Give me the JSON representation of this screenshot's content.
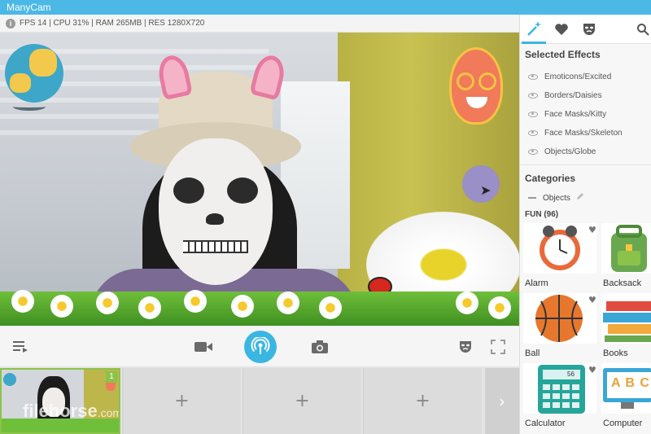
{
  "app": {
    "title": "ManyCam"
  },
  "stats": {
    "text": "FPS 14 | CPU 31% | RAM 265MB | RES 1280X720",
    "info_icon": "info-icon"
  },
  "colors": {
    "accent": "#3ab6e3",
    "title_bar": "#4cb8e6",
    "active_source": "#8bc34a"
  },
  "controls": {
    "playlist_icon": "playlist-icon",
    "video_icon": "video-camera-icon",
    "broadcast_icon": "broadcast-icon",
    "snapshot_icon": "camera-icon",
    "mask_icon": "mask-icon",
    "fullscreen_icon": "fullscreen-icon"
  },
  "sources": {
    "active_badge": "1",
    "add_label": "+",
    "next_label": "›",
    "watermark": "filehorse",
    "watermark_suffix": ".com"
  },
  "panel": {
    "tabs": [
      {
        "icon": "magic-wand-icon",
        "active": true
      },
      {
        "icon": "heart-icon",
        "active": false
      },
      {
        "icon": "mask-icon",
        "active": false
      }
    ],
    "search_icon": "search-icon",
    "selected_effects_title": "Selected Effects",
    "selected_effects": [
      "Emoticons/Excited",
      "Borders/Daisies",
      "Face Masks/Kitty",
      "Face Masks/Skeleton",
      "Objects/Globe"
    ],
    "categories_title": "Categories",
    "category": "Objects",
    "collapse_label": "—",
    "subcategory": "FUN (96)",
    "items": [
      {
        "label": "Alarm"
      },
      {
        "label": "Backsack"
      },
      {
        "label": "Ball"
      },
      {
        "label": "Books"
      },
      {
        "label": "Calculator"
      },
      {
        "label": "Computer"
      }
    ],
    "calculator_display": "56",
    "computer_screen": "A B C"
  }
}
